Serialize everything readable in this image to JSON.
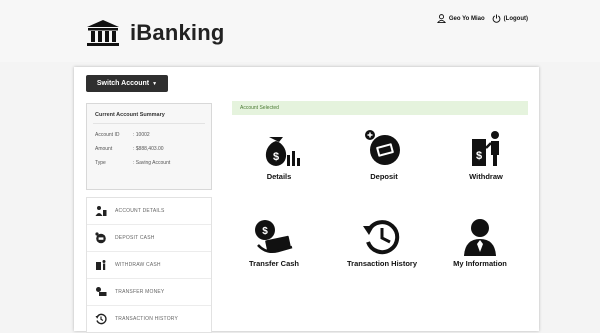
{
  "app": {
    "title": "iBanking"
  },
  "header": {
    "user_name": "Geo Yo Miao",
    "logout_label": "(Logout)",
    "user_icon": "user-icon",
    "logout_icon": "power-icon"
  },
  "toolbar": {
    "switch_account_label": "Switch Account"
  },
  "summary": {
    "title": "Current Account Summary",
    "rows": [
      {
        "label": "Account ID",
        "value": ": 10002"
      },
      {
        "label": "Amount",
        "value": ": $888,403.00"
      },
      {
        "label": "Type",
        "value": ": Saving Account"
      }
    ]
  },
  "sidebar": {
    "items": [
      {
        "label": "ACCOUNT DETAILS",
        "icon": "account-details-icon"
      },
      {
        "label": "DEPOSIT CASH",
        "icon": "deposit-icon"
      },
      {
        "label": "WITHDRAW CASH",
        "icon": "withdraw-icon"
      },
      {
        "label": "TRANSFER MONEY",
        "icon": "transfer-icon"
      },
      {
        "label": "TRANSACTION HISTORY",
        "icon": "history-icon"
      }
    ]
  },
  "alert": {
    "text": "Account Selected"
  },
  "tiles": [
    {
      "label": "Details",
      "icon": "money-bag-icon"
    },
    {
      "label": "Deposit",
      "icon": "deposit-icon"
    },
    {
      "label": "Withdraw",
      "icon": "withdraw-icon"
    },
    {
      "label": "Transfer Cash",
      "icon": "transfer-cash-icon"
    },
    {
      "label": "Transaction History",
      "icon": "history-icon"
    },
    {
      "label": "My Information",
      "icon": "user-icon"
    }
  ],
  "colors": {
    "alert_bg": "#e5f3dd",
    "button_bg": "#2f2f2f",
    "icon": "#111111"
  }
}
